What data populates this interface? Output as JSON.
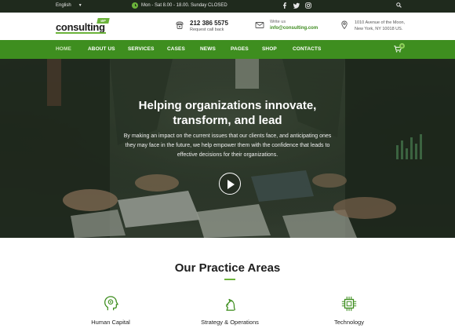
{
  "topbar": {
    "language": "English",
    "hours": "Mon - Sat 8.00 - 18.00. Sunday CLOSED",
    "social": [
      "facebook-icon",
      "twitter-icon",
      "instagram-icon"
    ]
  },
  "header": {
    "logo_text": "consulting",
    "logo_badge": "WP",
    "phone": "212 386 5575",
    "phone_sub": "Request call back",
    "mail_label": "Write us",
    "email": "info@consulting.com",
    "address_line1": "1010 Avenue of the Moon,",
    "address_line2": "New York, NY 10018 US."
  },
  "nav": {
    "items": [
      "HOME",
      "ABOUT US",
      "SERVICES",
      "CASES",
      "NEWS",
      "PAGES",
      "SHOP",
      "CONTACTS"
    ],
    "active": "HOME",
    "cart_count": "0"
  },
  "hero": {
    "title_line1": "Helping organizations innovate,",
    "title_line2": "transform, and lead",
    "text_line1": "By making an impact on the current issues that our clients face, and anticipating ones",
    "text_line2": "they may face in the future, we help empower them with the confidence that leads to",
    "text_line3": "effective decisions for their organizations."
  },
  "practice": {
    "title": "Our Practice Areas",
    "areas": [
      {
        "label": "Human Capital",
        "icon": "human-head-icon"
      },
      {
        "label": "Strategy & Operations",
        "icon": "chess-knight-icon"
      },
      {
        "label": "Technology",
        "icon": "chip-icon"
      }
    ]
  },
  "colors": {
    "accent": "#6bb33a",
    "nav": "#3e8e1f",
    "topbar": "#1f2a1d"
  }
}
